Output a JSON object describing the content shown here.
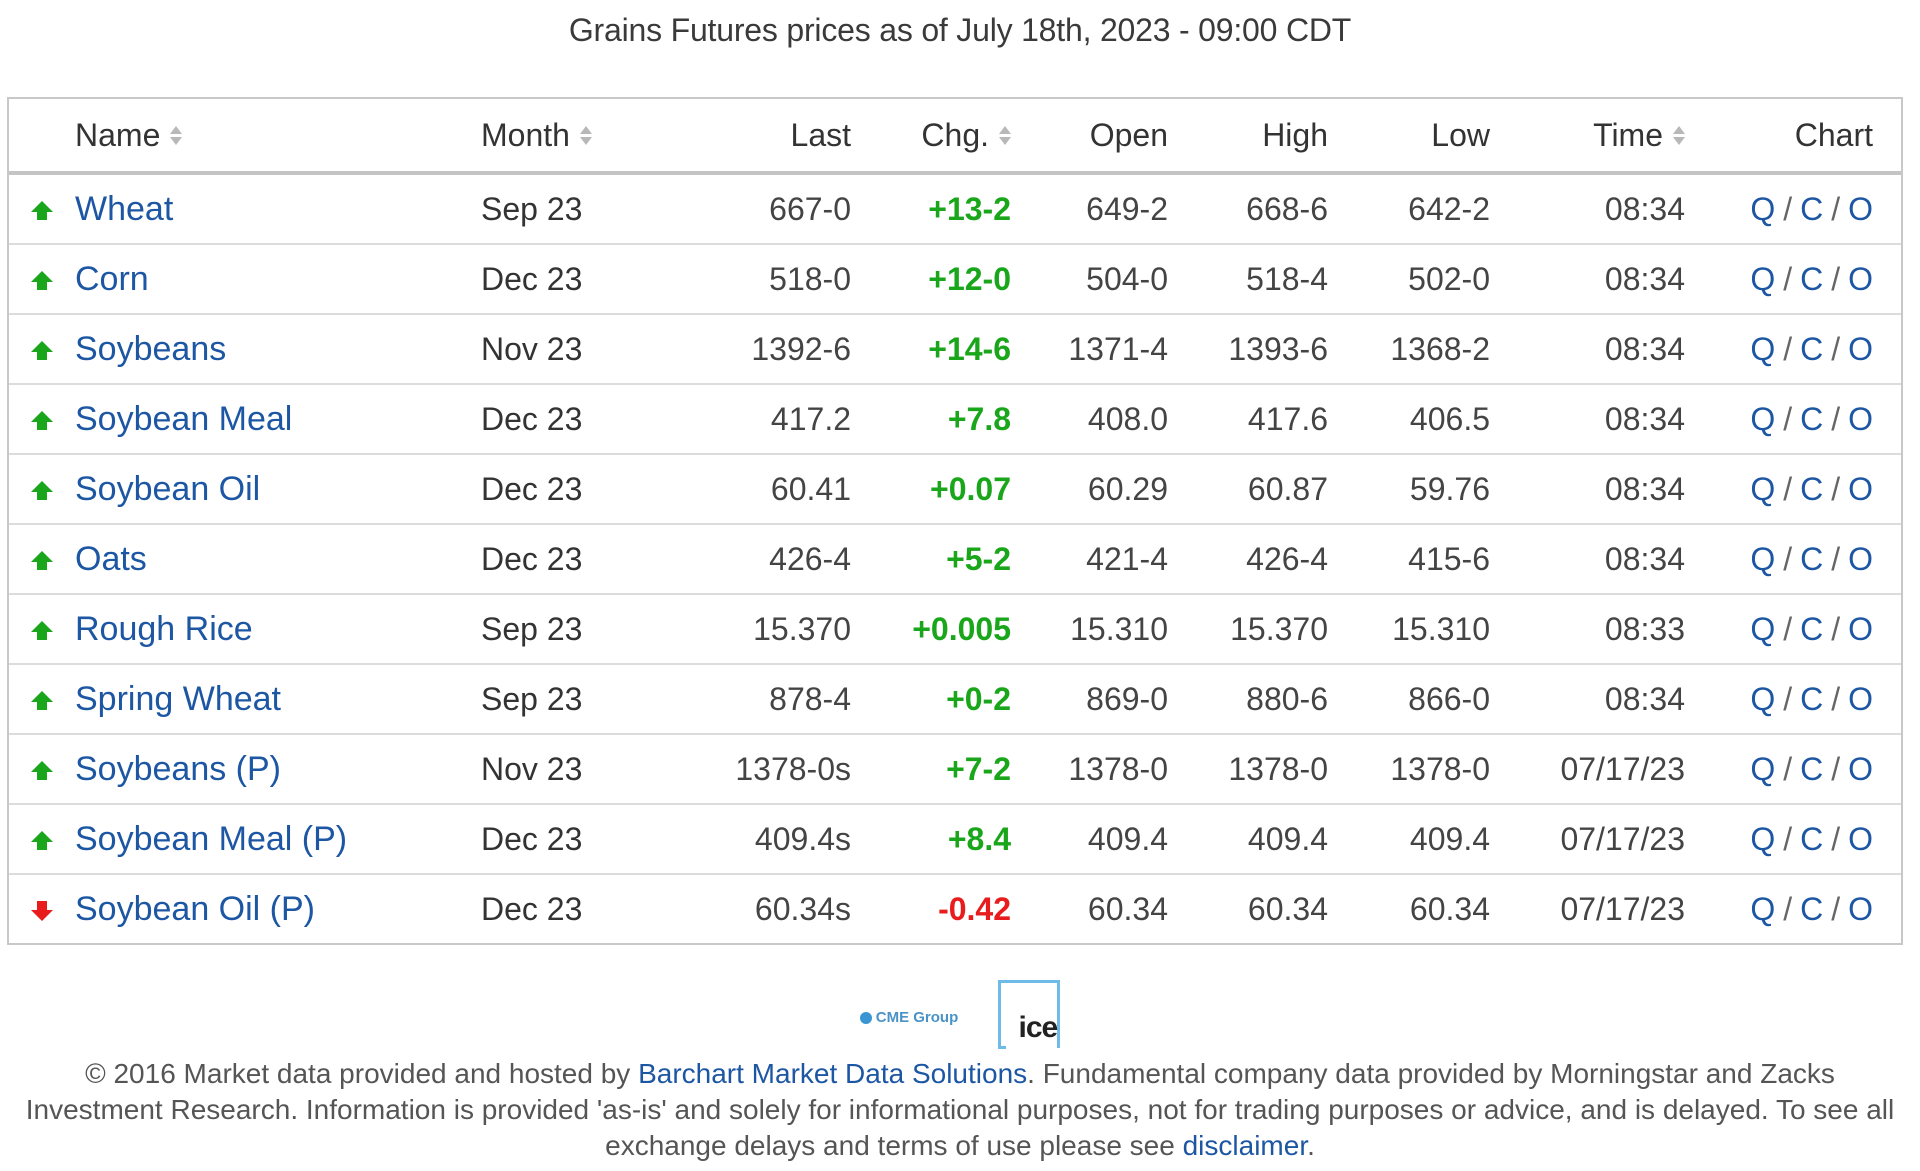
{
  "title": "Grains Futures prices as of July 18th, 2023 - 09:00 CDT",
  "colors": {
    "link": "#1d57a3",
    "up": "#1aa61a",
    "down": "#e81c1c",
    "text": "#444444"
  },
  "table": {
    "headers": {
      "name": "Name",
      "month": "Month",
      "last": "Last",
      "chg": "Chg.",
      "open": "Open",
      "high": "High",
      "low": "Low",
      "time": "Time",
      "chart": "Chart"
    },
    "sortable": [
      "name",
      "month",
      "chg",
      "time"
    ],
    "chart_links": [
      "Q",
      "C",
      "O"
    ],
    "chart_separator": "/",
    "rows": [
      {
        "direction": "up",
        "name": "Wheat",
        "month": "Sep 23",
        "last": "667-0",
        "chg": "+13-2",
        "open": "649-2",
        "high": "668-6",
        "low": "642-2",
        "time": "08:34"
      },
      {
        "direction": "up",
        "name": "Corn",
        "month": "Dec 23",
        "last": "518-0",
        "chg": "+12-0",
        "open": "504-0",
        "high": "518-4",
        "low": "502-0",
        "time": "08:34"
      },
      {
        "direction": "up",
        "name": "Soybeans",
        "month": "Nov 23",
        "last": "1392-6",
        "chg": "+14-6",
        "open": "1371-4",
        "high": "1393-6",
        "low": "1368-2",
        "time": "08:34"
      },
      {
        "direction": "up",
        "name": "Soybean Meal",
        "month": "Dec 23",
        "last": "417.2",
        "chg": "+7.8",
        "open": "408.0",
        "high": "417.6",
        "low": "406.5",
        "time": "08:34"
      },
      {
        "direction": "up",
        "name": "Soybean Oil",
        "month": "Dec 23",
        "last": "60.41",
        "chg": "+0.07",
        "open": "60.29",
        "high": "60.87",
        "low": "59.76",
        "time": "08:34"
      },
      {
        "direction": "up",
        "name": "Oats",
        "month": "Dec 23",
        "last": "426-4",
        "chg": "+5-2",
        "open": "421-4",
        "high": "426-4",
        "low": "415-6",
        "time": "08:34"
      },
      {
        "direction": "up",
        "name": "Rough Rice",
        "month": "Sep 23",
        "last": "15.370",
        "chg": "+0.005",
        "open": "15.310",
        "high": "15.370",
        "low": "15.310",
        "time": "08:33"
      },
      {
        "direction": "up",
        "name": "Spring Wheat",
        "month": "Sep 23",
        "last": "878-4",
        "chg": "+0-2",
        "open": "869-0",
        "high": "880-6",
        "low": "866-0",
        "time": "08:34"
      },
      {
        "direction": "up",
        "name": "Soybeans (P)",
        "month": "Nov 23",
        "last": "1378-0s",
        "chg": "+7-2",
        "open": "1378-0",
        "high": "1378-0",
        "low": "1378-0",
        "time": "07/17/23"
      },
      {
        "direction": "up",
        "name": "Soybean Meal (P)",
        "month": "Dec 23",
        "last": "409.4s",
        "chg": "+8.4",
        "open": "409.4",
        "high": "409.4",
        "low": "409.4",
        "time": "07/17/23"
      },
      {
        "direction": "down",
        "name": "Soybean Oil (P)",
        "month": "Dec 23",
        "last": "60.34s",
        "chg": "-0.42",
        "open": "60.34",
        "high": "60.34",
        "low": "60.34",
        "time": "07/17/23"
      }
    ]
  },
  "logos": {
    "cme": "CME Group",
    "ice": "ice"
  },
  "footer": {
    "text_1": "© 2016 Market data provided and hosted by ",
    "link_1": "Barchart Market Data Solutions",
    "text_2": ". Fundamental company data provided by Morningstar and Zacks Investment Research. Information is provided 'as-is' and solely for informational purposes, not for trading purposes or advice, and is delayed. To see all exchange delays and terms of use please see ",
    "link_2": "disclaimer",
    "text_3": "."
  }
}
